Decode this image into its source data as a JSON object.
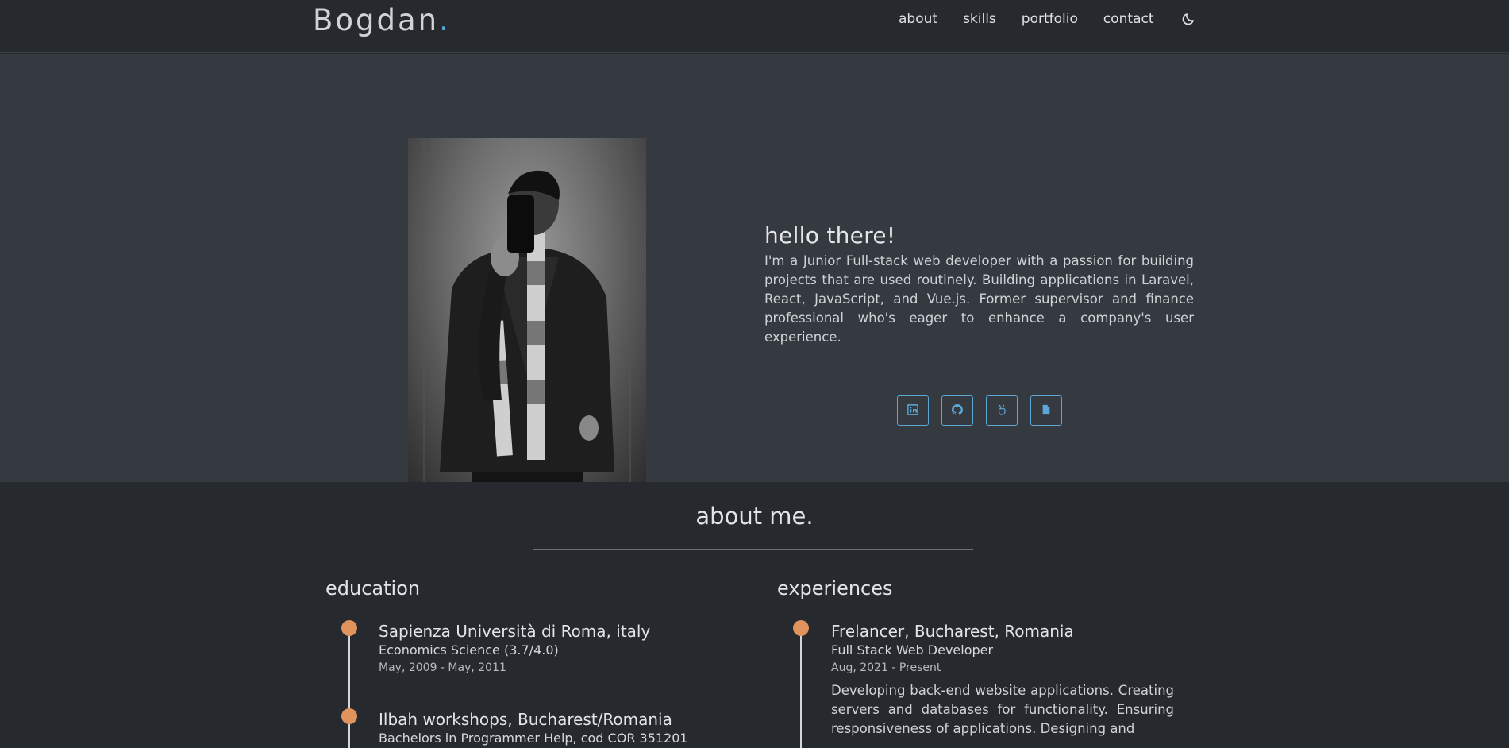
{
  "header": {
    "logo_text": "Bogdan",
    "logo_dot": ".",
    "nav": [
      "about",
      "skills",
      "portfolio",
      "contact"
    ],
    "theme_toggle_icon": "moon-icon"
  },
  "hero": {
    "heading": "hello there!",
    "bio": "I'm a Junior Full-stack web developer with a passion for building projects that are used routinely. Building applications in Laravel, React, JavaScript, and Vue.js. Former supervisor and finance professional who's eager to enhance a company's user experience.",
    "social_icons": [
      "linkedin-icon",
      "github-icon",
      "peace-hand-icon",
      "document-icon"
    ]
  },
  "about": {
    "title": "about me.",
    "education": {
      "title": "education",
      "items": [
        {
          "school": "Sapienza Università di Roma, italy",
          "degree": "Economics Science (3.7/4.0)",
          "dates": "May, 2009 - May, 2011"
        },
        {
          "school": "Ilbah workshops, Bucharest/Romania",
          "degree": "Bachelors in Programmer Help, cod COR 351201"
        }
      ]
    },
    "experiences": {
      "title": "experiences",
      "items": [
        {
          "company": "Frelancer, Bucharest, Romania",
          "role": "Full Stack Web Developer",
          "dates": "Aug, 2021 - Present",
          "description": "Developing back-end website applications. Creating servers and databases for functionality. Ensuring responsiveness of applications. Designing and"
        }
      ]
    }
  },
  "colors": {
    "accent": "#5ba7d6",
    "timeline_dot": "#e0935c",
    "background": "#26292e",
    "hero_background": "#353940"
  }
}
